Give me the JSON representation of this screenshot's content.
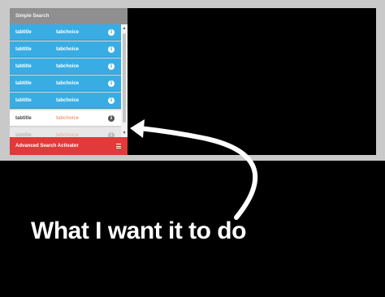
{
  "panel": {
    "header_title": "Simple Search",
    "rows": [
      {
        "title": "tabtitle",
        "choice": "tabchoice",
        "style": "blue"
      },
      {
        "title": "tabtitle",
        "choice": "tabchoice",
        "style": "blue"
      },
      {
        "title": "tabtitle",
        "choice": "tabchoice",
        "style": "blue"
      },
      {
        "title": "tabtitle",
        "choice": "tabchoice",
        "style": "blue"
      },
      {
        "title": "tabtitle",
        "choice": "tabchoice",
        "style": "blue"
      },
      {
        "title": "tabtitle",
        "choice": "tabchoice",
        "style": "white"
      },
      {
        "title": "tabtitle",
        "choice": "tabchoice",
        "style": "gray"
      }
    ],
    "info_glyph": "i",
    "footer_label": "Advanced Search Activator",
    "icons": {
      "info": "info-icon",
      "menu": "hamburger-menu-icon",
      "scroll_up": "chevron-up-icon",
      "scroll_down": "chevron-down-icon"
    }
  },
  "caption": "What I want it to do",
  "colors": {
    "row_blue": "#39ade3",
    "footer_red": "#e03a3a",
    "header_gray": "#8f8f8f",
    "frame": "#c9c9c9"
  }
}
